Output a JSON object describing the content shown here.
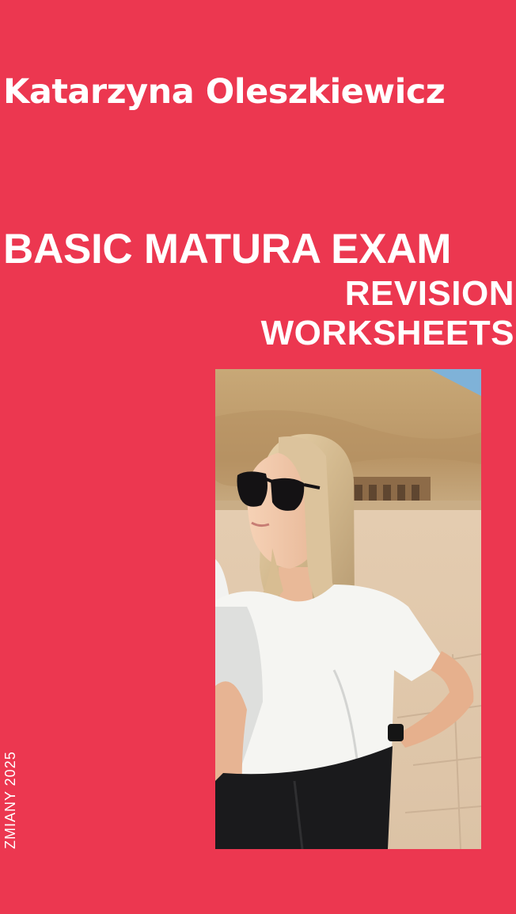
{
  "colors": {
    "background": "#ec3750",
    "text": "#ffffff"
  },
  "author": "Katarzyna Oleszkiewicz",
  "title": {
    "main": "BASIC MATURA EXAM",
    "line2": "REVISION",
    "line3": "WORKSHEETS"
  },
  "side_label": "ZMIANY 2025",
  "photo": {
    "icon": "portrait-photo"
  }
}
